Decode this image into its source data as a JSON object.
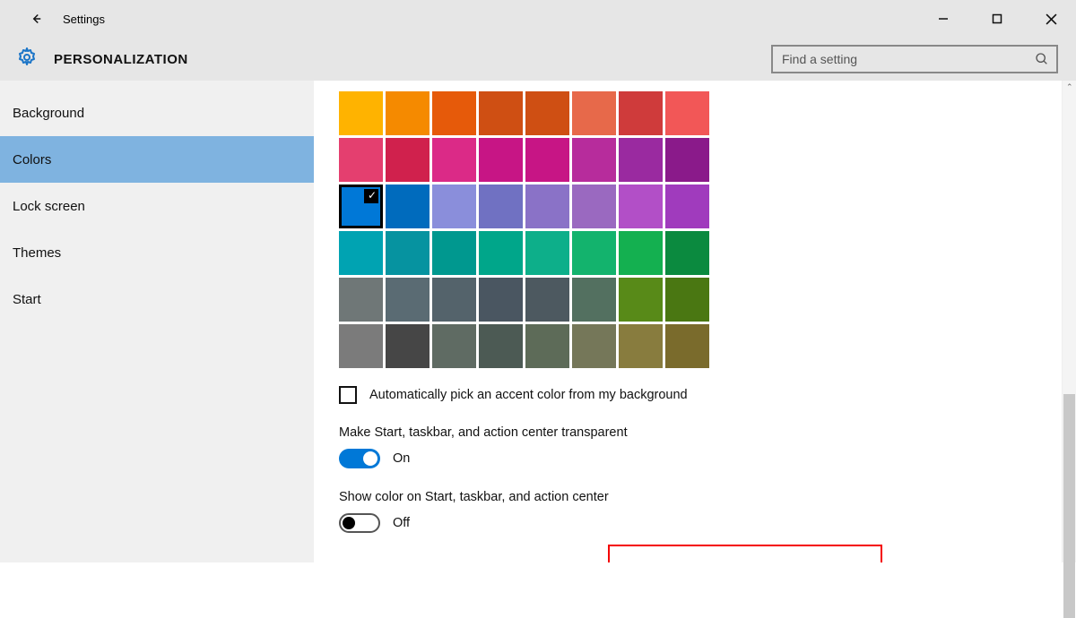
{
  "header": {
    "app_title": "Settings",
    "section_title": "PERSONALIZATION",
    "search_placeholder": "Find a setting"
  },
  "sidebar": {
    "items": [
      {
        "label": "Background",
        "active": false
      },
      {
        "label": "Colors",
        "active": true
      },
      {
        "label": "Lock screen",
        "active": false
      },
      {
        "label": "Themes",
        "active": false
      },
      {
        "label": "Start",
        "active": false
      }
    ]
  },
  "palette": {
    "selected_index": 16,
    "colors": [
      "#ffb300",
      "#f58a00",
      "#e65a0a",
      "#cf4f13",
      "#cf4f13",
      "#e7694a",
      "#cf3b3b",
      "#f25757",
      "#e43f6f",
      "#d0214d",
      "#db2a87",
      "#c71585",
      "#c71585",
      "#b72c9c",
      "#9a2aa0",
      "#8a1a8a",
      "#0078d7",
      "#006bbd",
      "#8a8edb",
      "#7071c2",
      "#8a72c7",
      "#9a69c0",
      "#b24fc7",
      "#a03bbd",
      "#00a3b2",
      "#0693a0",
      "#00988f",
      "#00a68a",
      "#0daf8a",
      "#13b36d",
      "#14b050",
      "#0b8a3f",
      "#6f7777",
      "#5a6b73",
      "#54636b",
      "#4a5661",
      "#4d5960",
      "#537060",
      "#588a18",
      "#4a7712",
      "#7b7b7b",
      "#464646",
      "#5f6b63",
      "#4c5a54",
      "#5d6b58",
      "#757759",
      "#887c3e",
      "#7a6b2c"
    ]
  },
  "options": {
    "auto_pick_label": "Automatically pick an accent color from my background",
    "auto_pick_checked": false,
    "transparent_label": "Make Start, taskbar, and action center transparent",
    "transparent_value": true,
    "transparent_value_text": "On",
    "show_color_label": "Show color on Start, taskbar, and action center",
    "show_color_value": false,
    "show_color_value_text": "Off"
  }
}
